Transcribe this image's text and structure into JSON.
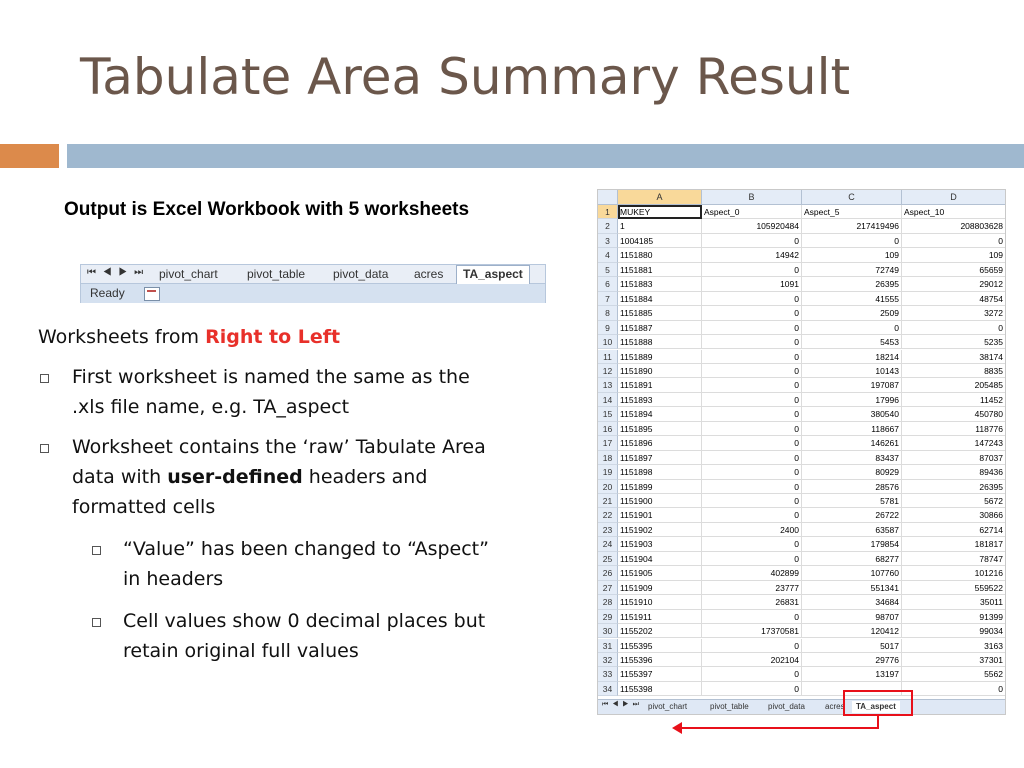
{
  "slide": {
    "title": "Tabulate Area Summary Result",
    "output_label": "Output is Excel Workbook with 5 worksheets",
    "worksheets_lead": "Worksheets from ",
    "worksheets_emph": "Right to Left",
    "bullet1_line1": "First worksheet is named the same as the",
    "bullet1_line2": ".xls file name, e.g. TA_aspect",
    "bullet2_line1": "Worksheet contains the ‘raw’ Tabulate Area",
    "bullet2_line2_pre": "data with ",
    "bullet2_line2_bold": "user-defined",
    "bullet2_line2_post": " headers and",
    "bullet2_line3": "formatted cells",
    "sub1_line1": "“Value” has been changed to “Aspect”",
    "sub1_line2": "in headers",
    "sub2_line1": "Cell values show 0 decimal places but",
    "sub2_line2": "retain original full values",
    "accent_orange": "#dc8a4b",
    "accent_blue": "#9fb8cf",
    "highlight_red": "#e8302a"
  },
  "mini_tabs": {
    "nav": "⏮ ◀ ▶ ⏭",
    "tabs": [
      "pivot_chart",
      "pivot_table",
      "pivot_data",
      "acres",
      "TA_aspect"
    ],
    "active": "TA_aspect",
    "status": "Ready"
  },
  "sheet": {
    "columns": [
      "A",
      "B",
      "C",
      "D"
    ],
    "header_row": [
      "MUKEY",
      "Aspect_0",
      "Aspect_5",
      "Aspect_10"
    ],
    "rows": [
      [
        "1",
        "105920484",
        "217419496",
        "208803628"
      ],
      [
        "1004185",
        "0",
        "0",
        "0"
      ],
      [
        "1151880",
        "14942",
        "109",
        "109"
      ],
      [
        "1151881",
        "0",
        "72749",
        "65659"
      ],
      [
        "1151883",
        "1091",
        "26395",
        "29012"
      ],
      [
        "1151884",
        "0",
        "41555",
        "48754"
      ],
      [
        "1151885",
        "0",
        "2509",
        "3272"
      ],
      [
        "1151887",
        "0",
        "0",
        "0"
      ],
      [
        "1151888",
        "0",
        "5453",
        "5235"
      ],
      [
        "1151889",
        "0",
        "18214",
        "38174"
      ],
      [
        "1151890",
        "0",
        "10143",
        "8835"
      ],
      [
        "1151891",
        "0",
        "197087",
        "205485"
      ],
      [
        "1151893",
        "0",
        "17996",
        "11452"
      ],
      [
        "1151894",
        "0",
        "380540",
        "450780"
      ],
      [
        "1151895",
        "0",
        "118667",
        "118776"
      ],
      [
        "1151896",
        "0",
        "146261",
        "147243"
      ],
      [
        "1151897",
        "0",
        "83437",
        "87037"
      ],
      [
        "1151898",
        "0",
        "80929",
        "89436"
      ],
      [
        "1151899",
        "0",
        "28576",
        "26395"
      ],
      [
        "1151900",
        "0",
        "5781",
        "5672"
      ],
      [
        "1151901",
        "0",
        "26722",
        "30866"
      ],
      [
        "1151902",
        "2400",
        "63587",
        "62714"
      ],
      [
        "1151903",
        "0",
        "179854",
        "181817"
      ],
      [
        "1151904",
        "0",
        "68277",
        "78747"
      ],
      [
        "1151905",
        "402899",
        "107760",
        "101216"
      ],
      [
        "1151909",
        "23777",
        "551341",
        "559522"
      ],
      [
        "1151910",
        "26831",
        "34684",
        "35011"
      ],
      [
        "1151911",
        "0",
        "98707",
        "91399"
      ],
      [
        "1155202",
        "17370581",
        "120412",
        "99034"
      ],
      [
        "1155395",
        "0",
        "5017",
        "3163"
      ],
      [
        "1155396",
        "202104",
        "29776",
        "37301"
      ],
      [
        "1155397",
        "0",
        "13197",
        "5562"
      ],
      [
        "1155398",
        "0",
        "",
        "0"
      ]
    ],
    "row_numbers": [
      "1",
      "2",
      "3",
      "4",
      "5",
      "6",
      "7",
      "8",
      "9",
      "10",
      "11",
      "12",
      "13",
      "14",
      "15",
      "16",
      "17",
      "18",
      "19",
      "20",
      "21",
      "22",
      "23",
      "24",
      "25",
      "26",
      "27",
      "28",
      "29",
      "30",
      "31",
      "32",
      "33",
      "34"
    ],
    "bottom_tabs": [
      "pivot_chart",
      "pivot_table",
      "pivot_data",
      "acres",
      "TA_aspect"
    ],
    "bottom_nav": "⏮ ◀ ▶ ⏭"
  }
}
